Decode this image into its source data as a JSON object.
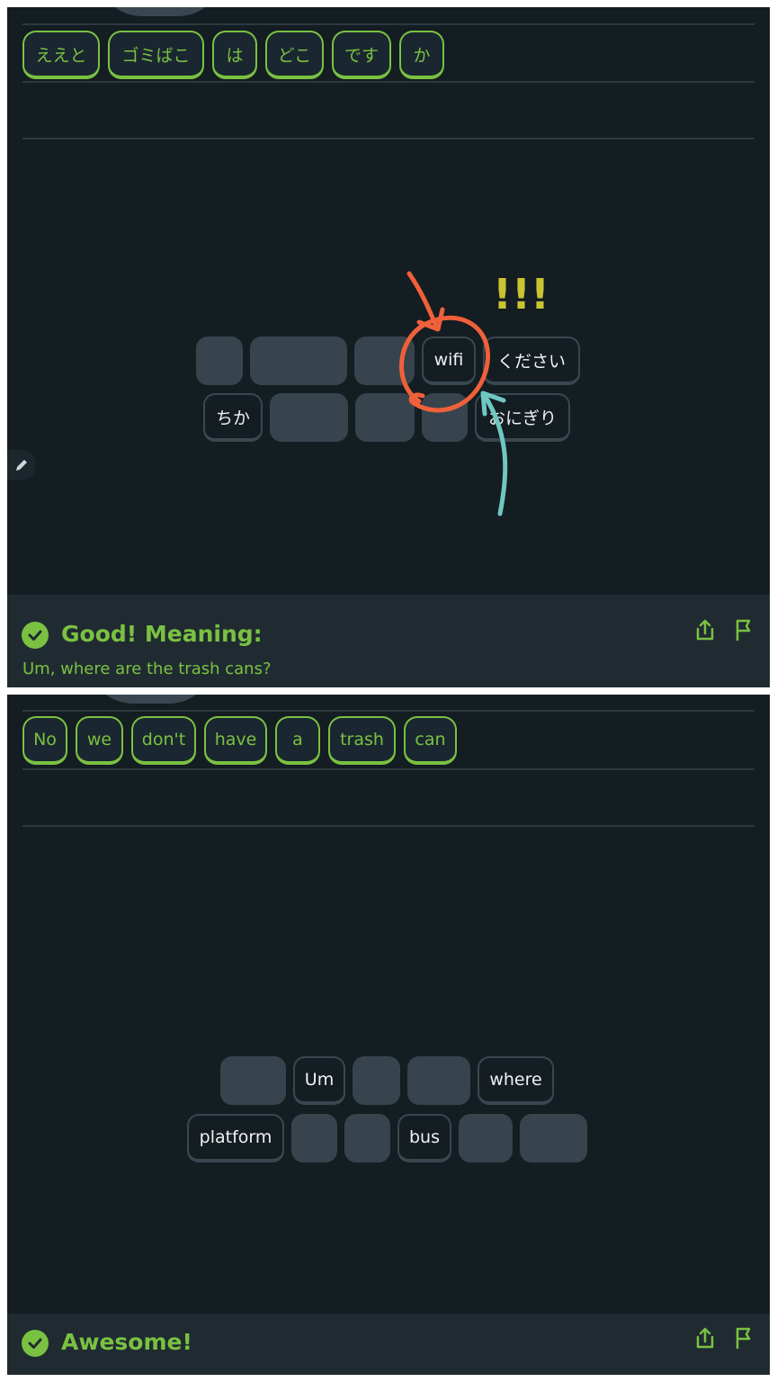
{
  "colors": {
    "background": "#141d22",
    "footer": "#202b31",
    "accent_green": "#7ac142",
    "tile_border": "#3a4750",
    "tile_used": "#37444d",
    "annotation_red": "#f0603a",
    "annotation_teal": "#6fc7c2",
    "annotation_yellow": "#c9c431"
  },
  "panel1": {
    "answer_words": [
      "ええと",
      "ゴミばこ",
      "は",
      "どこ",
      "です",
      "か"
    ],
    "bank_row1": [
      "",
      "",
      "",
      "wifi",
      "ください"
    ],
    "bank_row2": [
      "ちか",
      "",
      "",
      "",
      "おにぎり"
    ],
    "footer": {
      "headline": "Good! Meaning:",
      "meaning": "Um, where are the trash cans?"
    },
    "annotation_text": "!!!"
  },
  "panel2": {
    "answer_words": [
      "No",
      "we",
      "don't",
      "have",
      "a",
      "trash",
      "can"
    ],
    "bank_row1": [
      "",
      "Um",
      "",
      "",
      "where"
    ],
    "bank_row2": [
      "platform",
      "",
      "",
      "bus",
      "",
      ""
    ],
    "footer": {
      "headline": "Awesome!"
    }
  },
  "icons": [
    "check-icon",
    "share-icon",
    "flag-icon",
    "pencil-icon"
  ]
}
